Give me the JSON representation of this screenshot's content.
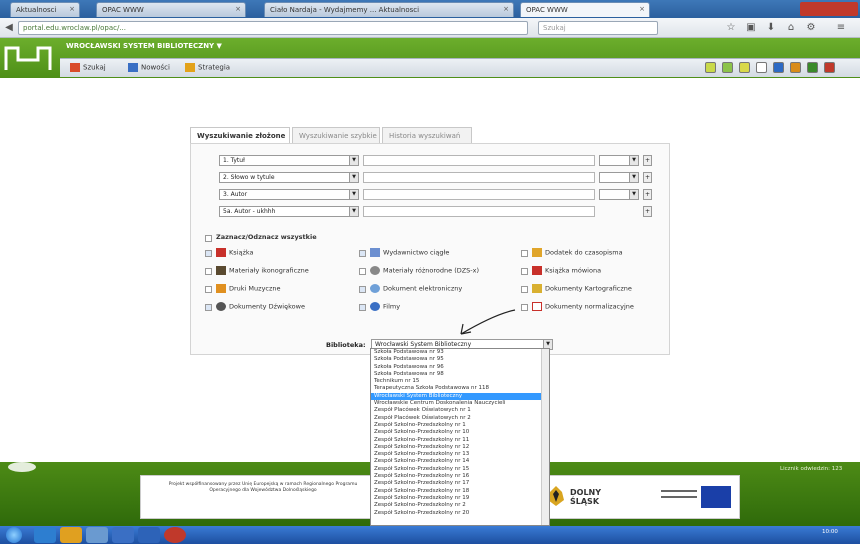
{
  "browser": {
    "tabs": [
      "Aktualnosci",
      "OPAC WWW",
      "Ciało Nardaja - Wydajmemy ... Aktualnosci",
      "OPAC WWW"
    ],
    "url": "portal.edu.wroclaw.pl/opac/...",
    "search_placeholder": "Szukaj"
  },
  "banner": {
    "title": "WROCŁAWSKI SYSTEM BIBLIOTECZNY ▼"
  },
  "bookmarks": [
    "Szukaj",
    "Nowości",
    "Strategia"
  ],
  "search_tabs": [
    "Wyszukiwanie złożone",
    "Wyszukiwanie szybkie",
    "Historia wyszukiwań"
  ],
  "fields": [
    "1. Tytuł",
    "2. Słowo w tytule",
    "3. Autor",
    "5a. Autor - ukhhh"
  ],
  "select_all": "Zaznacz/Odznacz wszystkie",
  "doc_types": [
    "Książka",
    "Wydawnictwo ciągłe",
    "Dodatek do czasopisma",
    "Materiały ikonograficzne",
    "Materiały różnorodne (DZS-x)",
    "Książka mówiona",
    "Druki Muzyczne",
    "Dokument elektroniczny",
    "Dokumenty Kartograficzne",
    "Dokumenty Dźwiękowe",
    "Filmy",
    "Dokumenty normalizacyjne"
  ],
  "library": {
    "label": "Biblioteka:",
    "selected": "Wrocławski System Biblioteczny",
    "options": [
      "Szkoła Podstawowa nr 93",
      "Szkoła Podstawowa nr 95",
      "Szkoła Podstawowa nr 96",
      "Szkoła Podstawowa nr 98",
      "Technikum nr 15",
      "Terapeutyczna Szkoła Podstawowa nr 118",
      "Wrocławski System Biblioteczny",
      "Wrocławskie Centrum Doskonalenia Nauczycieli",
      "Zespół Placówek Oświatowych nr 1",
      "Zespół Placówek Oświatowych nr 2",
      "Zespół Szkolno-Przedszkolny nr 1",
      "Zespół Szkolno-Przedszkolny nr 10",
      "Zespół Szkolno-Przedszkolny nr 11",
      "Zespół Szkolno-Przedszkolny nr 12",
      "Zespół Szkolno-Przedszkolny nr 13",
      "Zespół Szkolno-Przedszkolny nr 14",
      "Zespół Szkolno-Przedszkolny nr 15",
      "Zespół Szkolno-Przedszkolny nr 16",
      "Zespół Szkolno-Przedszkolny nr 17",
      "Zespół Szkolno-Przedszkolny nr 18",
      "Zespół Szkolno-Przedszkolny nr 19",
      "Zespół Szkolno-Przedszkolny nr 2",
      "Zespół Szkolno-Przedszkolny nr 20"
    ],
    "selected_index": 6
  },
  "footer": {
    "text": "Projekt współfinansowany przez Unię Europejską w ramach Regionalnego Programu Operacyjnego dla Województwa Dolnośląskiego",
    "dolny": "DOLNY ŚLĄSK",
    "counter": "Licznik odwiedzin: 123",
    "clock": "10:00"
  },
  "colors": {
    "banner_green": "#5c9e22",
    "highlight": "#3399ff"
  }
}
